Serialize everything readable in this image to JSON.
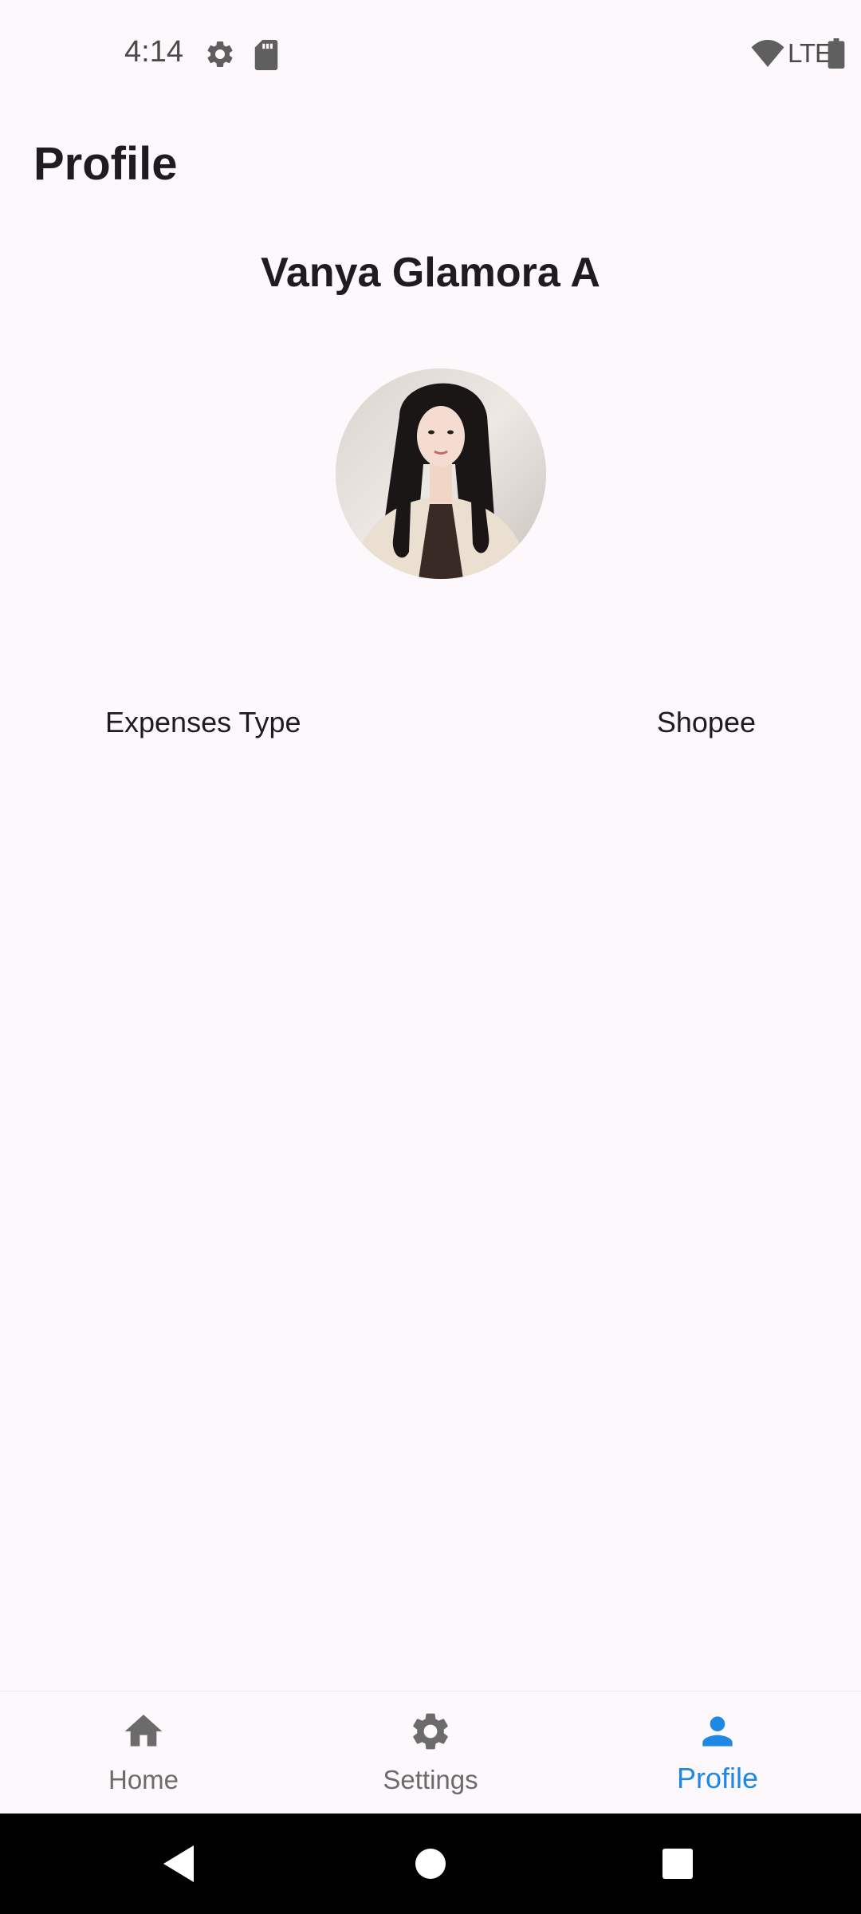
{
  "status_bar": {
    "time": "4:14",
    "network": "LTE",
    "icons": [
      "gear-icon",
      "sd-card-icon",
      "wifi-icon",
      "battery-icon"
    ]
  },
  "header": {
    "title": "Profile"
  },
  "profile": {
    "name": "Vanya Glamora A",
    "info": {
      "label": "Expenses Type",
      "value": "Shopee"
    }
  },
  "bottom_nav": {
    "items": [
      {
        "label": "Home",
        "icon": "home-icon",
        "active": false
      },
      {
        "label": "Settings",
        "icon": "settings-icon",
        "active": false
      },
      {
        "label": "Profile",
        "icon": "person-icon",
        "active": true
      }
    ],
    "active_color": "#1E88E5",
    "inactive_color": "#6B6B6B"
  },
  "system_nav": {
    "buttons": [
      "back-icon",
      "home-circle-icon",
      "recents-icon"
    ]
  }
}
